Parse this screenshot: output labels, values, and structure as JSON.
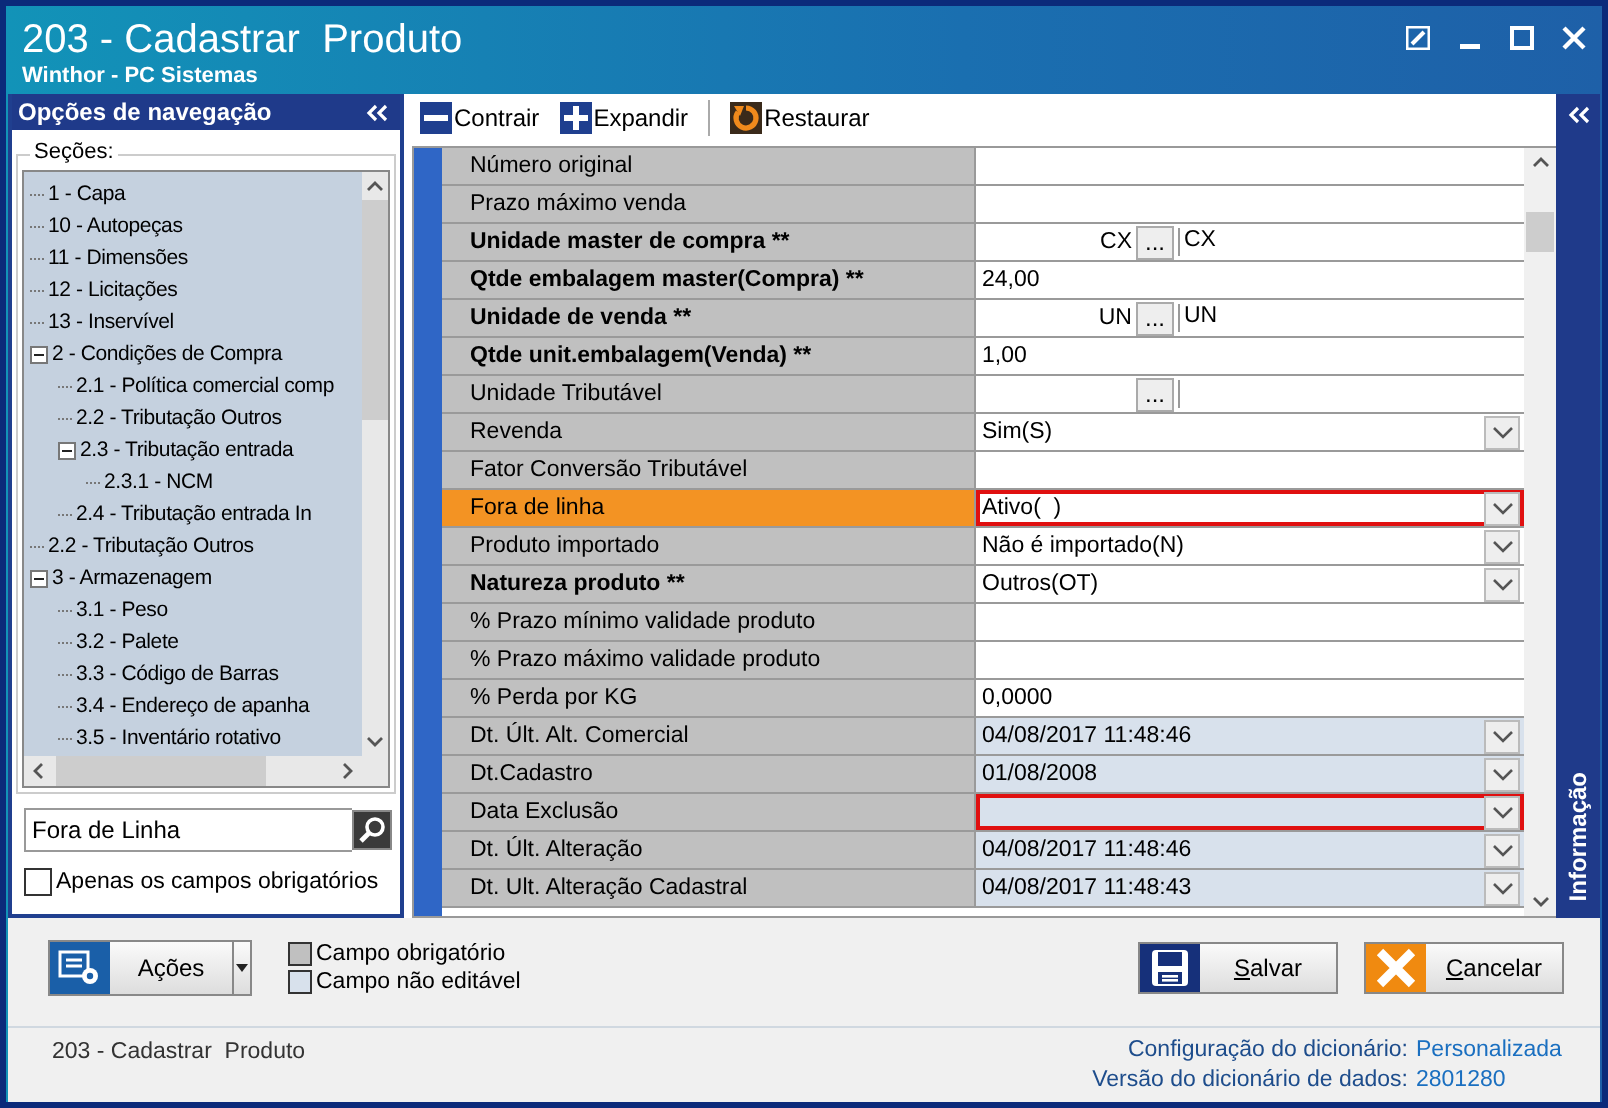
{
  "window": {
    "title": "203 - Cadastrar  Produto",
    "subtitle": "Winthor - PC Sistemas"
  },
  "nav": {
    "title": "Opções de navegação",
    "sections_label": "Seções:",
    "tree": [
      {
        "label": "1 - Capa"
      },
      {
        "label": "10 - Autopeças"
      },
      {
        "label": "11 - Dimensões"
      },
      {
        "label": "12 - Licitações"
      },
      {
        "label": "13 - Inservível"
      },
      {
        "label": "2 - Condições de Compra",
        "expanded": true,
        "children": [
          {
            "label": "2.1 - Política comercial comp"
          },
          {
            "label": "2.2 - Tributação Outros"
          },
          {
            "label": "2.3 - Tributação entrada",
            "expanded": true,
            "children": [
              {
                "label": "2.3.1 - NCM"
              }
            ]
          },
          {
            "label": "2.4 - Tributação entrada In"
          }
        ]
      },
      {
        "label": "2.2 - Tributação Outros"
      },
      {
        "label": "3 - Armazenagem",
        "expanded": true,
        "children": [
          {
            "label": "3.1 - Peso"
          },
          {
            "label": "3.2 - Palete"
          },
          {
            "label": "3.3 - Código de Barras"
          },
          {
            "label": "3.4 - Endereço de apanha"
          },
          {
            "label": "3.5 - Inventário rotativo"
          }
        ]
      }
    ],
    "search": {
      "value": "Fora de Linha"
    },
    "only_required": {
      "label": "Apenas os campos obrigatórios",
      "checked": false
    }
  },
  "toolbar": [
    {
      "label": "Contrair",
      "kind": "collapse"
    },
    {
      "label": "Expandir",
      "kind": "expand"
    },
    {
      "label": "Restaurar",
      "kind": "restore"
    }
  ],
  "fields": [
    {
      "label": "Número original",
      "bold": false,
      "kind": "text",
      "selected": false,
      "readonly": false,
      "flagged": false
    },
    {
      "label": "Prazo máximo venda",
      "bold": false,
      "kind": "text",
      "selected": false,
      "readonly": false,
      "flagged": false
    },
    {
      "label": "Unidade master de compra **",
      "bold": true,
      "kind": "lookup",
      "code": "CX",
      "button": "...",
      "value": "CX",
      "selected": false,
      "readonly": false,
      "flagged": false
    },
    {
      "label": "Qtde embalagem master(Compra) **",
      "bold": true,
      "kind": "text",
      "value": "24,00",
      "selected": false,
      "readonly": false,
      "flagged": false
    },
    {
      "label": "Unidade de venda **",
      "bold": true,
      "kind": "lookup",
      "code": "UN",
      "button": "...",
      "value": "UN",
      "selected": false,
      "readonly": false,
      "flagged": false
    },
    {
      "label": "Qtde unit.embalagem(Venda) **",
      "bold": true,
      "kind": "text",
      "value": "1,00",
      "selected": false,
      "readonly": false,
      "flagged": false
    },
    {
      "label": "Unidade Tributável",
      "bold": false,
      "kind": "lookup",
      "button": "...",
      "selected": false,
      "readonly": false,
      "flagged": false
    },
    {
      "label": "Revenda",
      "bold": false,
      "kind": "combo",
      "value": "Sim(S)",
      "selected": false,
      "readonly": false,
      "flagged": false
    },
    {
      "label": "Fator Conversão Tributável",
      "bold": false,
      "kind": "text",
      "selected": false,
      "readonly": false,
      "flagged": false
    },
    {
      "label": "Fora de linha",
      "bold": false,
      "kind": "combo",
      "value": "Ativo(  )",
      "selected": true,
      "readonly": false,
      "flagged": true
    },
    {
      "label": "Produto importado",
      "bold": false,
      "kind": "combo",
      "value": "Não é importado(N)",
      "selected": false,
      "readonly": false,
      "flagged": false
    },
    {
      "label": "Natureza produto **",
      "bold": true,
      "kind": "combo",
      "value": "Outros(OT)",
      "selected": false,
      "readonly": false,
      "flagged": false
    },
    {
      "label": "% Prazo mínimo validade produto",
      "bold": false,
      "kind": "text",
      "selected": false,
      "readonly": false,
      "flagged": false
    },
    {
      "label": "% Prazo máximo validade produto",
      "bold": false,
      "kind": "text",
      "selected": false,
      "readonly": false,
      "flagged": false
    },
    {
      "label": "% Perda por KG",
      "bold": false,
      "kind": "text",
      "value": "0,0000",
      "selected": false,
      "readonly": false,
      "flagged": false
    },
    {
      "label": "Dt. Últ. Alt. Comercial",
      "bold": false,
      "kind": "combo",
      "value": "04/08/2017 11:48:46",
      "selected": false,
      "readonly": true,
      "flagged": false
    },
    {
      "label": "Dt.Cadastro",
      "bold": false,
      "kind": "combo",
      "value": "01/08/2008",
      "selected": false,
      "readonly": true,
      "flagged": false
    },
    {
      "label": "Data Exclusão",
      "bold": false,
      "kind": "combo",
      "selected": false,
      "readonly": true,
      "flagged": true
    },
    {
      "label": "Dt. Últ. Alteração",
      "bold": false,
      "kind": "combo",
      "value": "04/08/2017 11:48:46",
      "selected": false,
      "readonly": true,
      "flagged": false
    },
    {
      "label": "Dt. Ult. Alteração Cadastral",
      "bold": false,
      "kind": "combo",
      "value": "04/08/2017 11:48:43",
      "selected": false,
      "readonly": true,
      "flagged": false
    }
  ],
  "info_tab": "Informação",
  "actions": {
    "label": "Ações"
  },
  "legend": [
    {
      "label": "Campo obrigatório",
      "kind": "required"
    },
    {
      "label": "Campo não editável",
      "kind": "readonly"
    }
  ],
  "buttons": [
    {
      "label": "Salvar",
      "kind": "save"
    },
    {
      "label": "Cancelar",
      "kind": "cancel"
    }
  ],
  "status": {
    "text": "203 - Cadastrar  Produto",
    "info": [
      {
        "label": "Configuração do dicionário:",
        "value": "Personalizada"
      },
      {
        "label": "Versão do dicionário de dados:",
        "value": "2801280"
      }
    ]
  }
}
